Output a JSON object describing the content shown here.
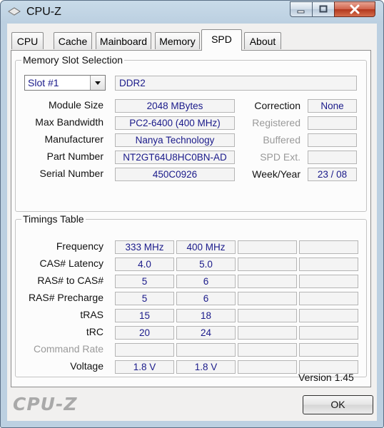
{
  "window": {
    "title": "CPU-Z"
  },
  "tabs": [
    {
      "label": "CPU"
    },
    {
      "label": "Cache"
    },
    {
      "label": "Mainboard"
    },
    {
      "label": "Memory"
    },
    {
      "label": "SPD"
    },
    {
      "label": "About"
    }
  ],
  "active_tab": "SPD",
  "slot_selection": {
    "group_label": "Memory Slot Selection",
    "slot_value": "Slot #1",
    "memory_type": "DDR2",
    "module_size_label": "Module Size",
    "module_size": "2048 MBytes",
    "max_bandwidth_label": "Max Bandwidth",
    "max_bandwidth": "PC2-6400 (400 MHz)",
    "manufacturer_label": "Manufacturer",
    "manufacturer": "Nanya Technology",
    "part_number_label": "Part Number",
    "part_number": "NT2GT64U8HC0BN-AD",
    "serial_number_label": "Serial Number",
    "serial_number": "450C0926",
    "correction_label": "Correction",
    "correction": "None",
    "registered_label": "Registered",
    "registered": "",
    "buffered_label": "Buffered",
    "buffered": "",
    "spd_ext_label": "SPD Ext.",
    "spd_ext": "",
    "week_year_label": "Week/Year",
    "week_year": "23 / 08"
  },
  "timings": {
    "group_label": "Timings Table",
    "rows": [
      {
        "label": "Frequency",
        "values": [
          "333 MHz",
          "400 MHz",
          "",
          ""
        ],
        "dim": false
      },
      {
        "label": "CAS# Latency",
        "values": [
          "4.0",
          "5.0",
          "",
          ""
        ],
        "dim": false
      },
      {
        "label": "RAS# to CAS#",
        "values": [
          "5",
          "6",
          "",
          ""
        ],
        "dim": false
      },
      {
        "label": "RAS# Precharge",
        "values": [
          "5",
          "6",
          "",
          ""
        ],
        "dim": false
      },
      {
        "label": "tRAS",
        "values": [
          "15",
          "18",
          "",
          ""
        ],
        "dim": false
      },
      {
        "label": "tRC",
        "values": [
          "20",
          "24",
          "",
          ""
        ],
        "dim": false
      },
      {
        "label": "Command Rate",
        "values": [
          "",
          "",
          "",
          ""
        ],
        "dim": true
      },
      {
        "label": "Voltage",
        "values": [
          "1.8 V",
          "1.8 V",
          "",
          ""
        ],
        "dim": false
      }
    ]
  },
  "footer": {
    "version": "Version 1.45",
    "brand": "CPU-Z",
    "ok_label": "OK"
  },
  "colors": {
    "value_text": "#1a1a8a",
    "title_bar": "#bcd0e1",
    "close_button": "#c94f33"
  }
}
